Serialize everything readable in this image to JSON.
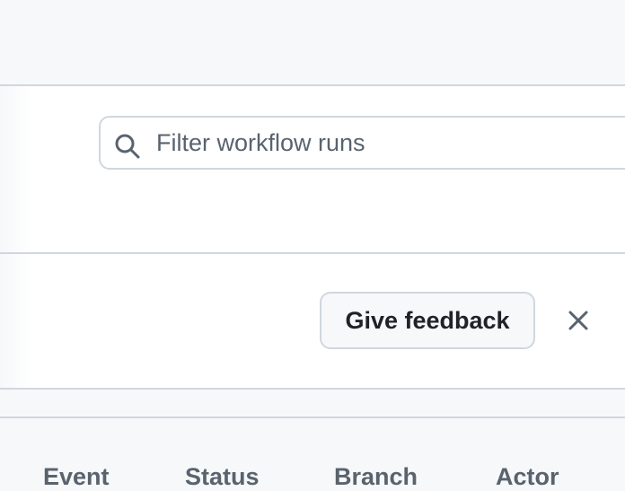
{
  "search": {
    "placeholder": "Filter workflow runs",
    "value": ""
  },
  "feedback": {
    "button_label": "Give feedback"
  },
  "table": {
    "columns": [
      "Event",
      "Status",
      "Branch",
      "Actor"
    ]
  },
  "icons": {
    "search": "search-icon",
    "close": "close-icon"
  },
  "colors": {
    "border": "#d0d7de",
    "muted_text": "#59636e",
    "text": "#1f2328",
    "canvas_subtle": "#f6f8fa"
  }
}
